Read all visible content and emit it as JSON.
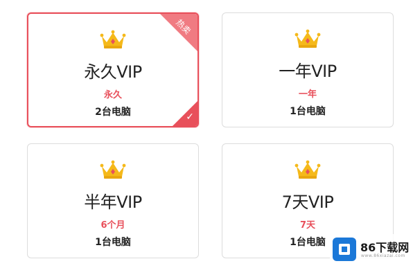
{
  "plans": [
    {
      "title": "永久VIP",
      "duration": "永久",
      "devices": "2台电脑",
      "selected": true,
      "badge": "热卖"
    },
    {
      "title": "一年VIP",
      "duration": "一年",
      "devices": "1台电脑",
      "selected": false
    },
    {
      "title": "半年VIP",
      "duration": "6个月",
      "devices": "1台电脑",
      "selected": false
    },
    {
      "title": "7天VIP",
      "duration": "7天",
      "devices": "1台电脑",
      "selected": false
    }
  ],
  "icons": {
    "plan_icon": "crown-icon",
    "selected_icon": "checkmark-icon"
  },
  "colors": {
    "accent": "#e8505b",
    "crown_gold": "#f5b91a",
    "crown_jewel": "#e8505b",
    "border": "#dcdcdc"
  },
  "watermark": {
    "brand": "86下载网",
    "domain": "www.86xiazai.com"
  }
}
